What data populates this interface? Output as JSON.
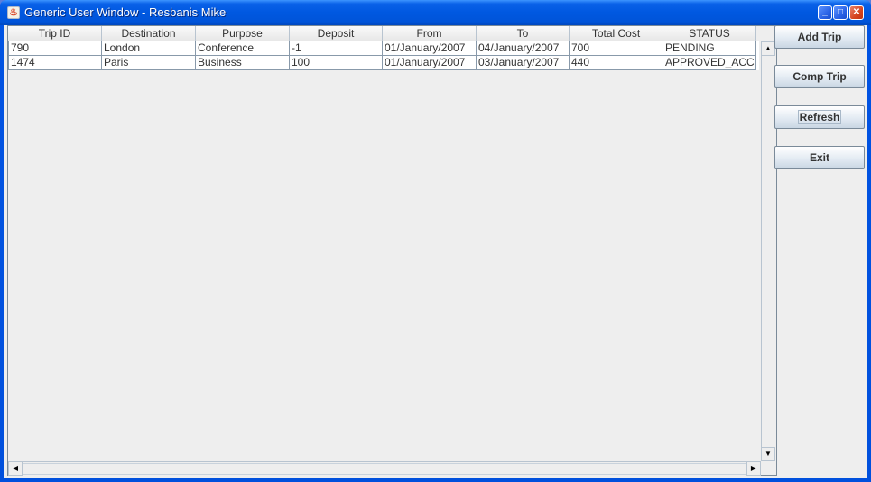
{
  "window": {
    "title": "Generic User Window - Resbanis Mike",
    "controls": {
      "minimize": "_",
      "maximize": "□",
      "close": "✕"
    }
  },
  "table": {
    "columns": [
      "Trip ID",
      "Destination",
      "Purpose",
      "Deposit",
      "From",
      "To",
      "Total Cost",
      "STATUS"
    ],
    "rows": [
      [
        "790",
        "London",
        "Conference",
        "-1",
        "01/January/2007",
        "04/January/2007",
        "700",
        "PENDING"
      ],
      [
        "1474",
        "Paris",
        "Business",
        "100",
        "01/January/2007",
        "03/January/2007",
        "440",
        "APPROVED_ACC"
      ]
    ]
  },
  "scrollbar": {
    "up": "▲",
    "down": "▼",
    "left": "◀",
    "right": "▶"
  },
  "buttons": {
    "add_trip": "Add Trip",
    "comp_trip": "Comp Trip",
    "refresh": "Refresh",
    "exit": "Exit"
  }
}
